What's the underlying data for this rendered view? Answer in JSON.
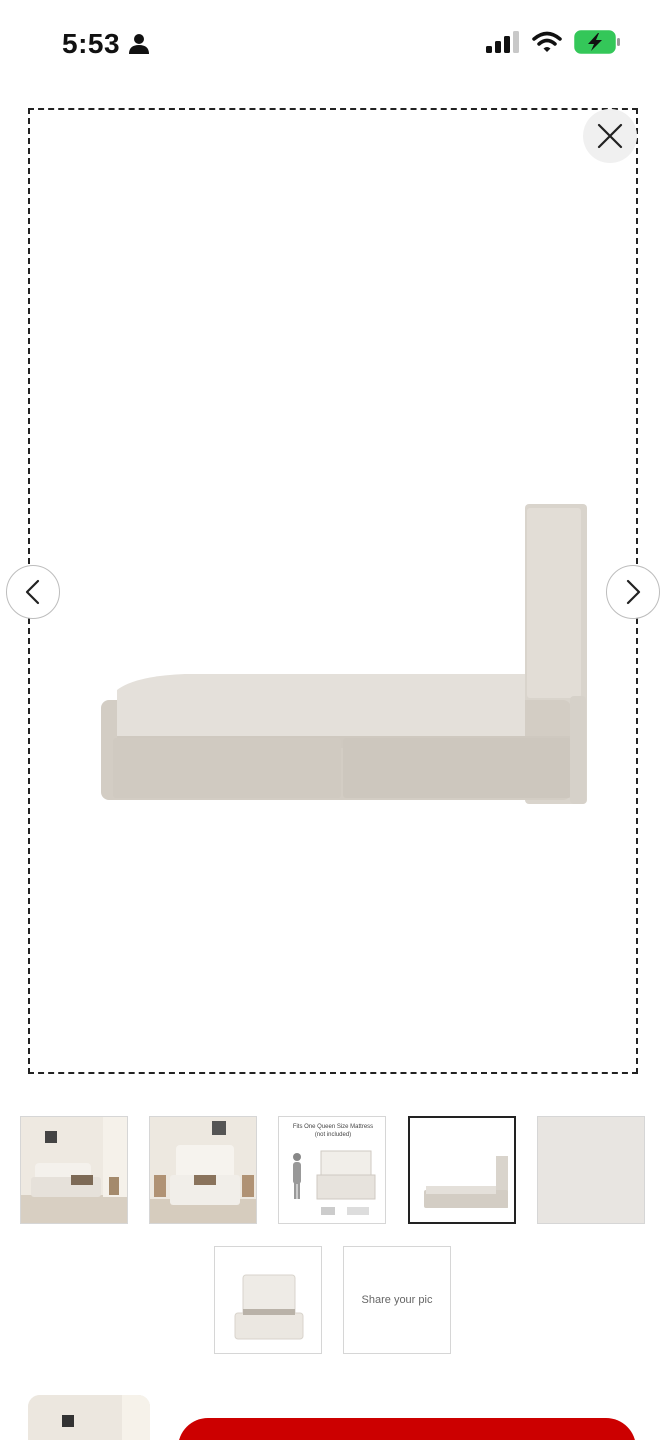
{
  "status_bar": {
    "time": "5:53",
    "icons": [
      "person-icon",
      "cellular-signal-icon",
      "wifi-icon",
      "battery-charging-icon"
    ],
    "battery_color": "#34c759"
  },
  "viewer": {
    "close_icon": "close-icon",
    "prev_icon": "chevron-left-icon",
    "next_icon": "chevron-right-icon",
    "image_alt": "Upholstered bed with storage drawers, side view"
  },
  "thumbnails": [
    {
      "id": "bedroom-scene-1",
      "selected": false
    },
    {
      "id": "bedroom-scene-2",
      "selected": false
    },
    {
      "id": "dimensions-diagram",
      "selected": false,
      "title": "Fits One Queen Size Mattress",
      "subtitle": "(not included)"
    },
    {
      "id": "bed-side-view",
      "selected": true
    },
    {
      "id": "fabric-swatch",
      "selected": false
    },
    {
      "id": "bed-front-view",
      "selected": false
    },
    {
      "id": "share-your-pic",
      "selected": false,
      "label": "Share your pic"
    }
  ],
  "bottom_bar": {
    "accent_color": "#cc0000"
  }
}
